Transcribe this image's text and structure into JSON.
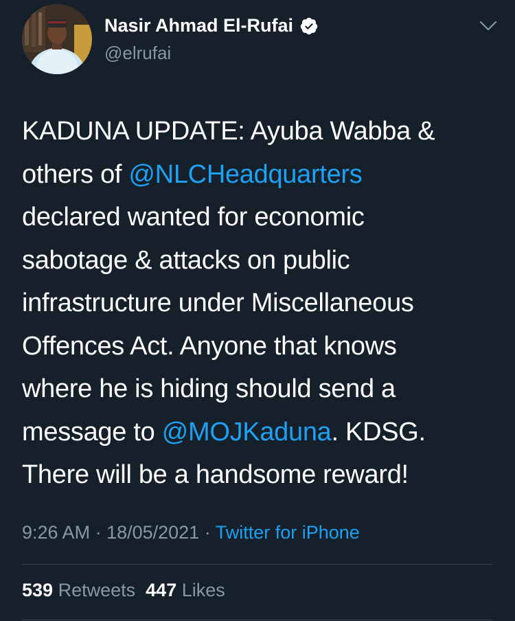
{
  "tweet": {
    "author": {
      "display_name": "Nasir Ahmad El-Rufai",
      "handle": "@elrufai",
      "verified": true,
      "avatar_icon": "profile-photo"
    },
    "text_segments": [
      [
        {
          "text": "KADUNA UPDATE: Ayuba Wabba &",
          "type": "text"
        }
      ],
      [
        {
          "text": "others of ",
          "type": "text"
        },
        {
          "text": "@NLCHeadquarters",
          "type": "mention"
        }
      ],
      [
        {
          "text": "declared wanted for economic",
          "type": "text"
        }
      ],
      [
        {
          "text": "sabotage & attacks on public",
          "type": "text"
        }
      ],
      [
        {
          "text": "infrastructure under Miscellaneous",
          "type": "text"
        }
      ],
      [
        {
          "text": "Offences Act. Anyone that knows",
          "type": "text"
        }
      ],
      [
        {
          "text": "where he is hiding should send a",
          "type": "text"
        }
      ],
      [
        {
          "text": "message to ",
          "type": "text"
        },
        {
          "text": "@MOJKaduna",
          "type": "mention"
        },
        {
          "text": ". KDSG.",
          "type": "text"
        }
      ],
      [
        {
          "text": "There will be a handsome reward!",
          "type": "text"
        }
      ]
    ],
    "meta": {
      "time": "9:26 AM",
      "separator": " · ",
      "date": "18/05/2021",
      "source": "Twitter for iPhone"
    },
    "stats": {
      "retweets_count": "539",
      "retweets_label": "Retweets",
      "likes_count": "447",
      "likes_label": "Likes"
    },
    "colors": {
      "background": "#15202b",
      "accent": "#1da1f2",
      "secondary_text": "#8899a6"
    },
    "icons": {
      "verified": "verified-badge-icon",
      "menu": "chevron-down-icon"
    }
  }
}
